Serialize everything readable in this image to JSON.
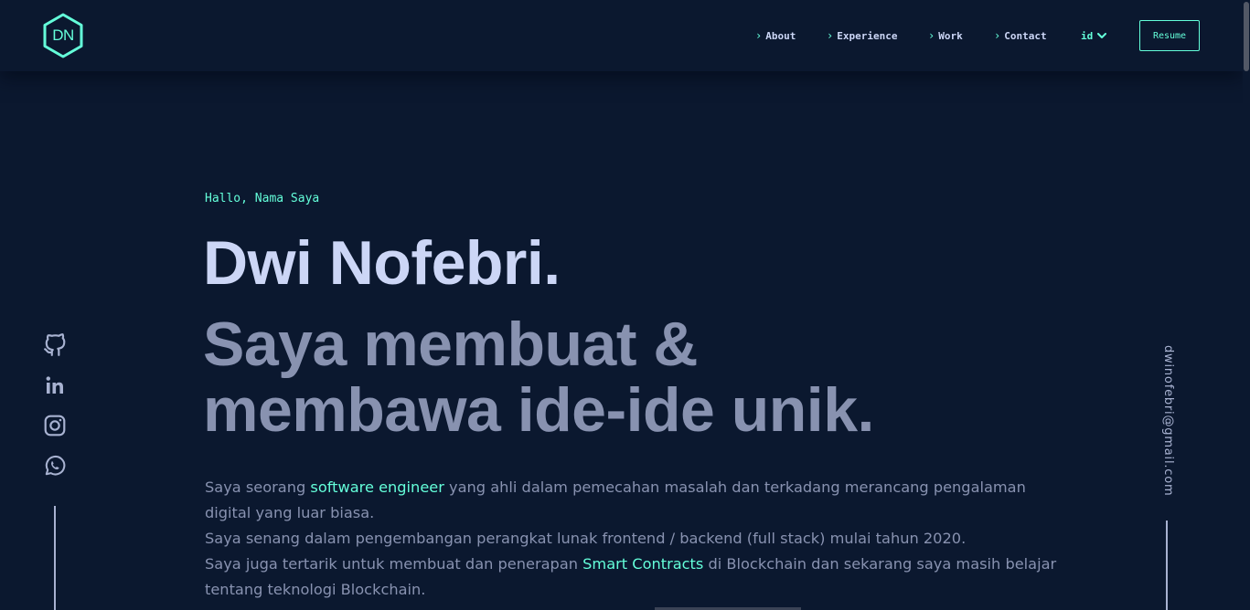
{
  "header": {
    "logo_text": "DN",
    "nav": [
      {
        "label": "About"
      },
      {
        "label": "Experience"
      },
      {
        "label": "Work"
      },
      {
        "label": "Contact"
      }
    ],
    "language": "id",
    "resume_label": "Resume"
  },
  "hero": {
    "greeting": "Hallo, Nama Saya",
    "name": "Dwi Nofebri.",
    "tagline_line1": "Saya membuat &",
    "tagline_line2": "membawa ide-ide unik.",
    "intro": {
      "p1_before": "Saya seorang ",
      "p1_highlight": "software engineer",
      "p1_after": " yang ahli dalam pemecahan masalah dan terkadang merancang pengalaman digital yang luar biasa.",
      "p2": "Saya senang dalam pengembangan perangkat lunak frontend / backend (full stack) mulai tahun 2020.",
      "p3_before": "Saya juga tertarik untuk membuat dan penerapan ",
      "p3_highlight": "Smart Contracts",
      "p3_after": " di Blockchain dan sekarang saya masih belajar tentang teknologi Blockchain."
    }
  },
  "socials": [
    {
      "icon": "github-icon"
    },
    {
      "icon": "linkedin-icon"
    },
    {
      "icon": "instagram-icon"
    },
    {
      "icon": "whatsapp-icon"
    }
  ],
  "email": "dwinofebri@gmail.com",
  "colors": {
    "background": "#0b182f",
    "accent": "#64ffda",
    "heading": "#ccd6f6",
    "body_text": "#8892b0"
  }
}
